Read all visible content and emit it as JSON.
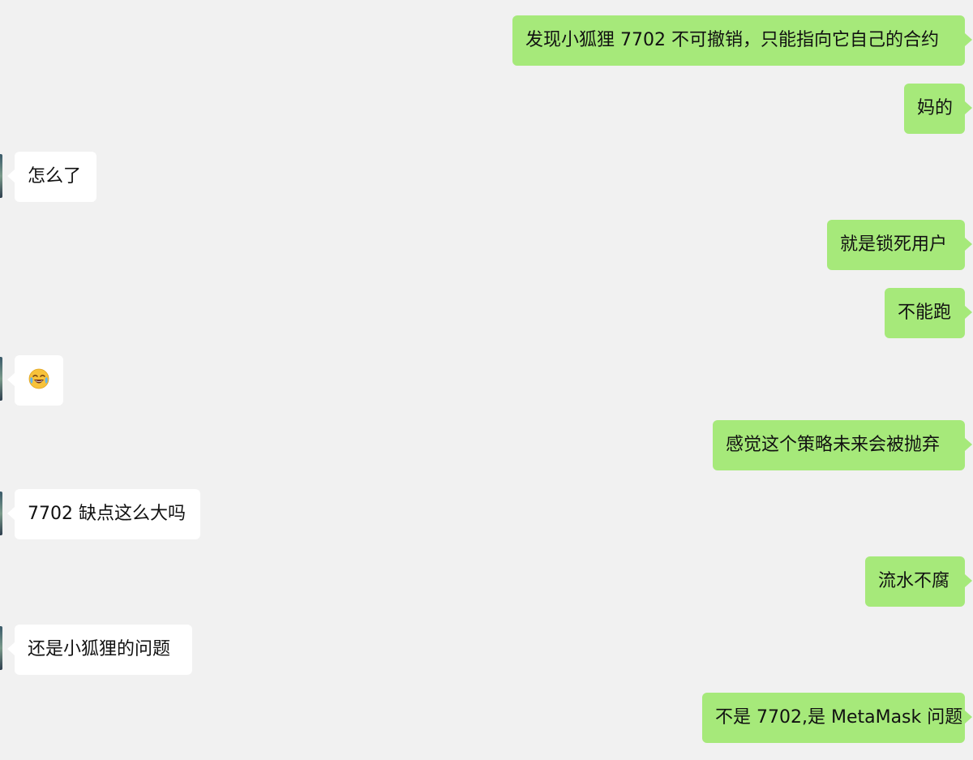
{
  "messages": [
    {
      "side": "sent",
      "text": "发现小狐狸 7702 不可撤销，只能指向它自己的合约"
    },
    {
      "side": "sent",
      "text": "妈的"
    },
    {
      "side": "received",
      "text": "怎么了"
    },
    {
      "side": "sent",
      "text": "就是锁死用户"
    },
    {
      "side": "sent",
      "text": "不能跑"
    },
    {
      "side": "received",
      "emoji": "face-with-tears-of-joy-emoji"
    },
    {
      "side": "sent",
      "text": "感觉这个策略未来会被抛弃"
    },
    {
      "side": "received",
      "text": "7702 缺点这么大吗"
    },
    {
      "side": "sent",
      "text": "流水不腐"
    },
    {
      "side": "received",
      "text": "还是小狐狸的问题"
    },
    {
      "side": "sent",
      "text": "不是 7702,是 MetaMask 问题"
    }
  ],
  "colors": {
    "background": "#f1f1f1",
    "sent_bubble": "#a6e97a",
    "received_bubble": "#ffffff"
  }
}
